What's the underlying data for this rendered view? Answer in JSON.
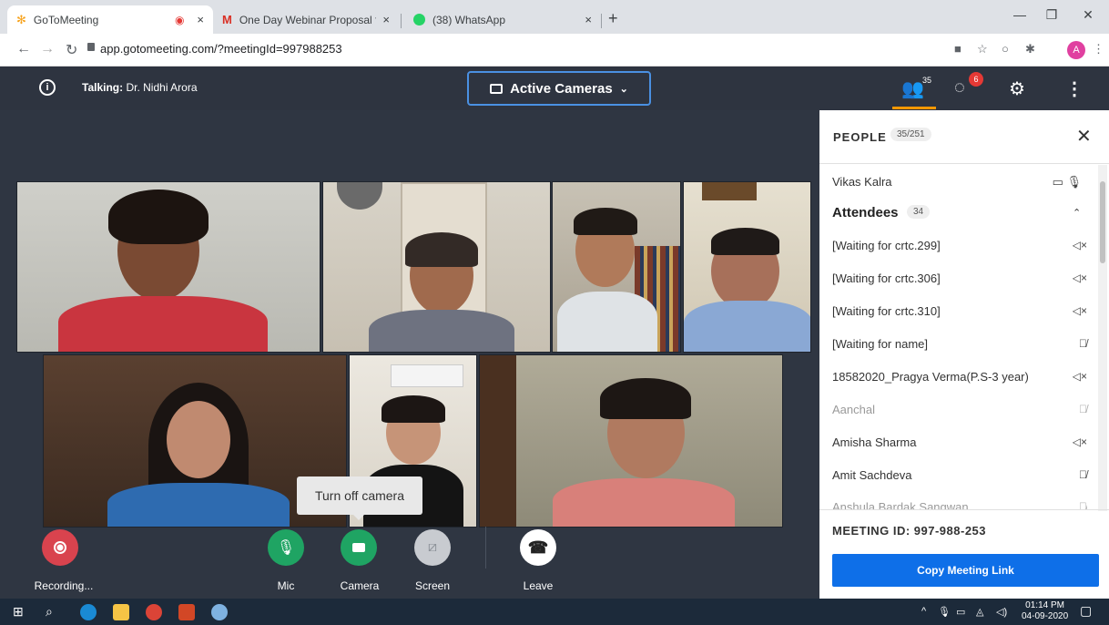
{
  "browser": {
    "tabs": [
      {
        "title": "GoToMeeting",
        "active": true
      },
      {
        "title": "One Day Webinar Proposal from",
        "active": false
      },
      {
        "title": "(38) WhatsApp",
        "active": false
      }
    ],
    "url": "app.gotomeeting.com/?meetingId=997988253",
    "profile_initial": "A"
  },
  "header": {
    "talking_label": "Talking:",
    "talking_name": "Dr. Nidhi Arora",
    "view_label": "Active Cameras",
    "people_count": "35",
    "chat_badge": "6"
  },
  "tooltip": "Turn off camera",
  "controls": {
    "recording": "Recording...",
    "mic": "Mic",
    "camera": "Camera",
    "screen": "Screen",
    "leave": "Leave"
  },
  "panel": {
    "title": "PEOPLE",
    "count": "35/251",
    "organizer": "Vikas Kalra",
    "attendees_label": "Attendees",
    "attendees_count": "34",
    "attendees": [
      {
        "name": "[Waiting for crtc.299]",
        "icon": "⊲×",
        "dim": false
      },
      {
        "name": "[Waiting for crtc.306]",
        "icon": "⊲×",
        "dim": false
      },
      {
        "name": "[Waiting for crtc.310]",
        "icon": "⊲×",
        "dim": false
      },
      {
        "name": "[Waiting for name]",
        "icon": "mic-off",
        "dim": false
      },
      {
        "name": "18582020_Pragya Verma(P.S-3 year)",
        "icon": "⊲×",
        "dim": false
      },
      {
        "name": "Aanchal",
        "icon": "mic-off",
        "dim": true
      },
      {
        "name": "Amisha Sharma",
        "icon": "⊲×",
        "dim": false
      },
      {
        "name": "Amit Sachdeva",
        "icon": "mic-off",
        "dim": false
      },
      {
        "name": "Anshula Bardak Sangwan",
        "icon": "mic-off",
        "dim": true
      }
    ],
    "meeting_id": "MEETING ID: 997-988-253",
    "copy_link": "Copy Meeting Link"
  },
  "taskbar": {
    "time": "01:14 PM",
    "date": "04-09-2020"
  },
  "colors": {
    "accent": "#0e6fe8",
    "header_bg": "#2e3440",
    "recording": "#e03c4e",
    "mic_green": "#1fa463"
  }
}
